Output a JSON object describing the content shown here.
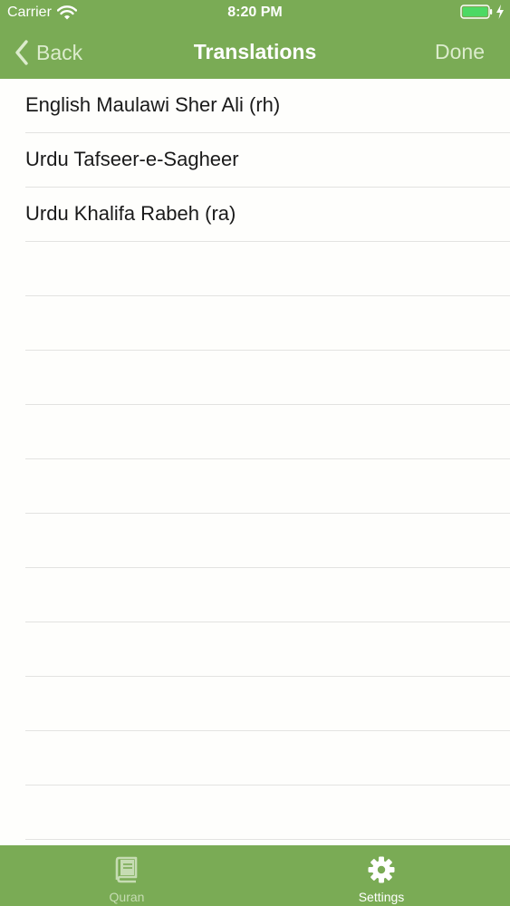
{
  "status_bar": {
    "carrier": "Carrier",
    "time": "8:20 PM",
    "wifi_icon": "wifi-icon",
    "battery_icon": "battery-icon",
    "charging_icon": "charging-bolt-icon"
  },
  "nav": {
    "back_label": "Back",
    "title": "Translations",
    "done_label": "Done",
    "back_icon": "chevron-left-icon"
  },
  "translations": [
    {
      "label": "English Maulawi Sher Ali (rh)"
    },
    {
      "label": "Urdu Tafseer-e-Sagheer"
    },
    {
      "label": "Urdu Khalifa Rabeh (ra)"
    }
  ],
  "tab_bar": {
    "items": [
      {
        "label": "Quran",
        "icon": "book-icon",
        "selected": false
      },
      {
        "label": "Settings",
        "icon": "gear-icon",
        "selected": true
      }
    ]
  },
  "colors": {
    "accent": "#7aab55",
    "nav_button_text": "#dceccd",
    "tab_inactive": "#c6dcb3",
    "separator": "#e3e3e1",
    "battery_fill": "#4cd964"
  }
}
